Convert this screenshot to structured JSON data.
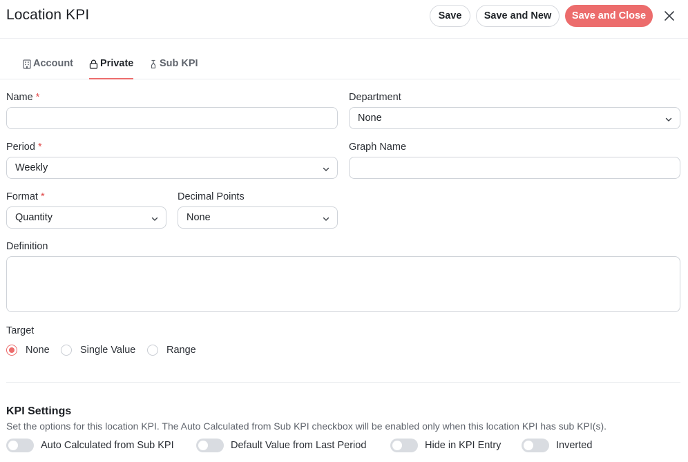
{
  "header": {
    "title": "Location KPI",
    "save_label": "Save",
    "save_new_label": "Save and New",
    "save_close_label": "Save and Close"
  },
  "tabs": [
    {
      "label": "Account",
      "icon": "building-icon",
      "active": false
    },
    {
      "label": "Private",
      "icon": "lock-icon",
      "active": true
    },
    {
      "label": "Sub KPI",
      "icon": "link-icon",
      "active": false
    }
  ],
  "form": {
    "name": {
      "label": "Name",
      "required_mark": "*",
      "value": ""
    },
    "department": {
      "label": "Department",
      "value": "None"
    },
    "period": {
      "label": "Period",
      "required_mark": "*",
      "value": "Weekly"
    },
    "graph_name": {
      "label": "Graph Name",
      "value": ""
    },
    "format": {
      "label": "Format",
      "required_mark": "*",
      "value": "Quantity"
    },
    "decimal_points": {
      "label": "Decimal Points",
      "value": "None"
    },
    "definition": {
      "label": "Definition",
      "value": ""
    },
    "target": {
      "label": "Target",
      "options": [
        "None",
        "Single Value",
        "Range"
      ],
      "selected": "None"
    }
  },
  "kpi_settings": {
    "title": "KPI Settings",
    "description": "Set the options for this location KPI. The Auto Calculated from Sub KPI checkbox will be enabled only when this location KPI has sub KPI(s).",
    "toggles": [
      {
        "label": "Auto Calculated from Sub KPI",
        "on": false
      },
      {
        "label": "Default Value from Last Period",
        "on": false
      },
      {
        "label": "Hide in KPI Entry",
        "on": false
      },
      {
        "label": "Inverted",
        "on": false
      }
    ]
  },
  "colors": {
    "accent": "#ec6c6c",
    "required": "#e04a4a",
    "border": "#cfd3d9",
    "toggle_off": "#d9dce1"
  }
}
